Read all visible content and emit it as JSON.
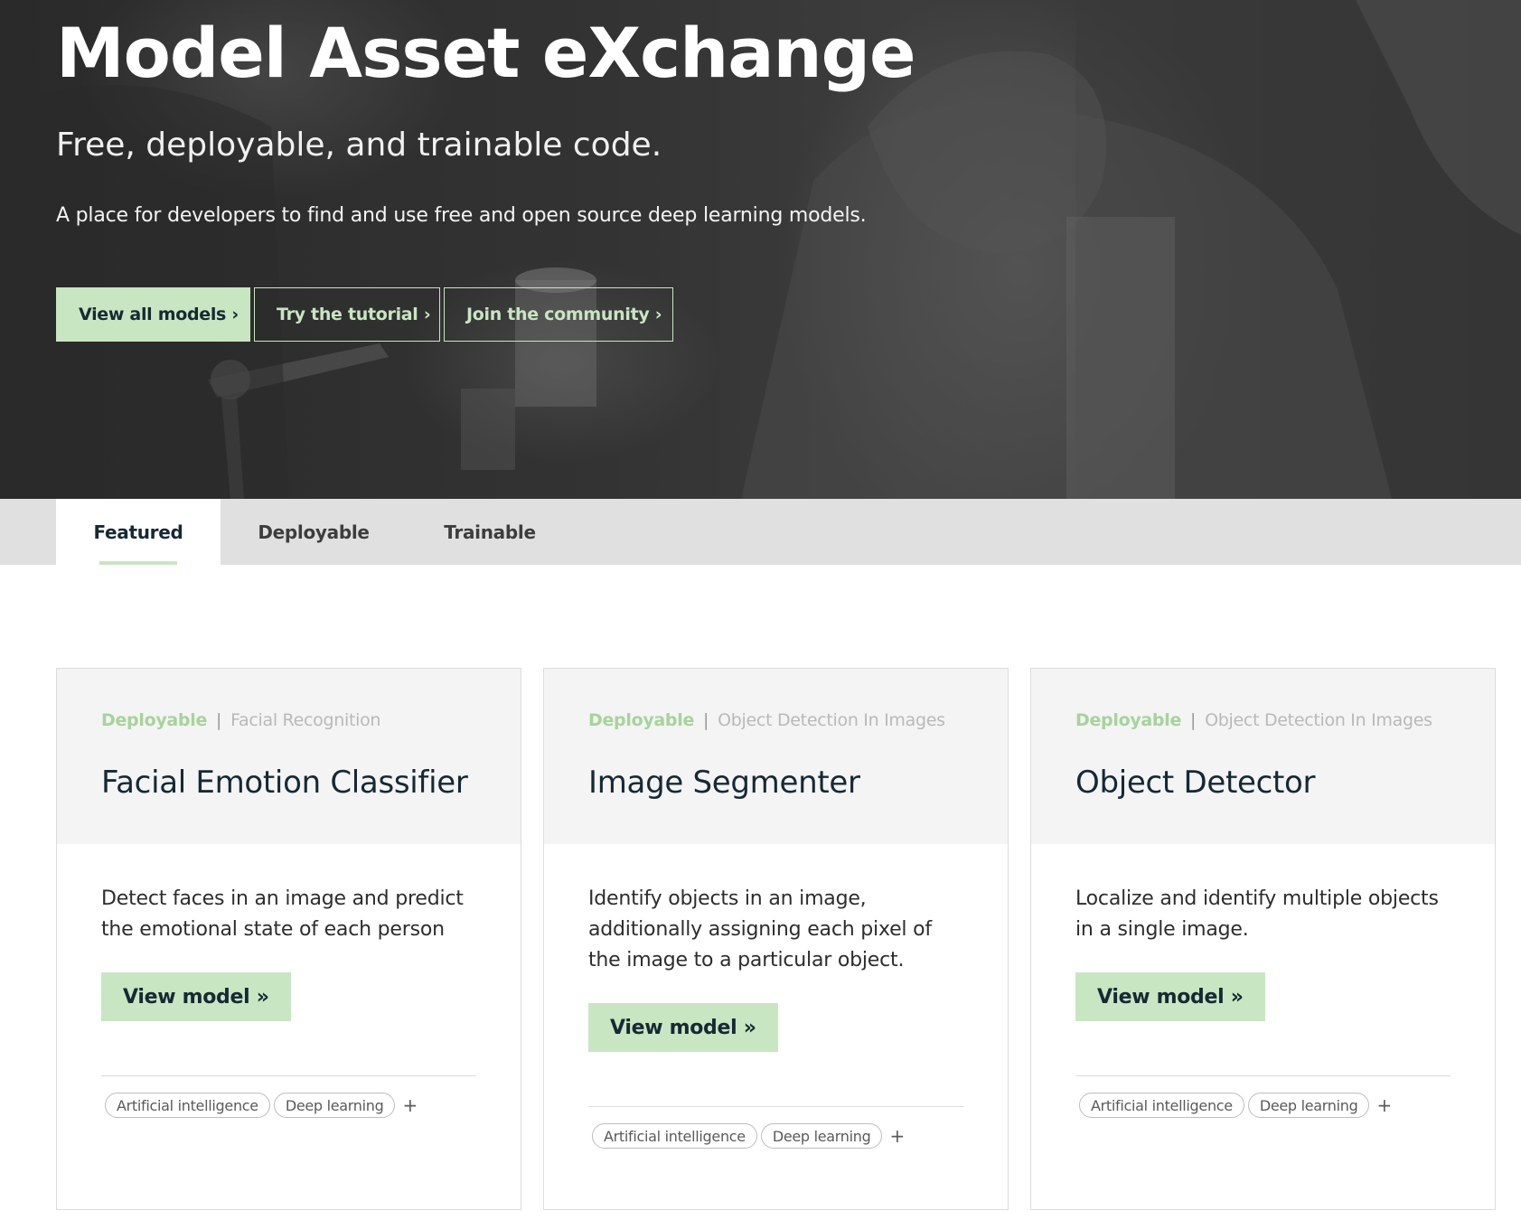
{
  "hero": {
    "title": "Model Asset eXchange",
    "subtitle": "Free, deployable, and trainable code.",
    "description": "A place for developers to find and use free and open source deep learning models.",
    "buttons": [
      {
        "label": "View all models ›"
      },
      {
        "label": "Try the tutorial ›"
      },
      {
        "label": "Join the community ›"
      }
    ]
  },
  "tabs": [
    {
      "label": "Featured",
      "active": true
    },
    {
      "label": "Deployable",
      "active": false
    },
    {
      "label": "Trainable",
      "active": false
    }
  ],
  "cards": [
    {
      "type": "Deployable",
      "separator": "|",
      "category": "Facial Recognition",
      "title": "Facial Emotion Classifier",
      "description": "Detect faces in an image and predict the emotional state of each person",
      "button": "View model »",
      "tags": [
        "Artificial intelligence",
        "Deep learning"
      ],
      "more": "+"
    },
    {
      "type": "Deployable",
      "separator": "|",
      "category": "Object Detection In Images",
      "title": "Image Segmenter",
      "description": "Identify objects in an image, additionally assigning each pixel of the image to a particular object.",
      "button": "View model »",
      "tags": [
        "Artificial intelligence",
        "Deep learning"
      ],
      "more": "+"
    },
    {
      "type": "Deployable",
      "separator": "|",
      "category": "Object Detection In Images",
      "title": "Object Detector",
      "description": "Localize and identify multiple objects in a single image.",
      "button": "View model »",
      "tags": [
        "Artificial intelligence",
        "Deep learning"
      ],
      "more": "+"
    }
  ],
  "colors": {
    "accent_green": "#c8e6c1",
    "type_label_green": "#a6d49b",
    "hero_dark": "#2e2e2e",
    "tab_bar": "#e0e0e0",
    "card_head": "#f4f4f4"
  }
}
